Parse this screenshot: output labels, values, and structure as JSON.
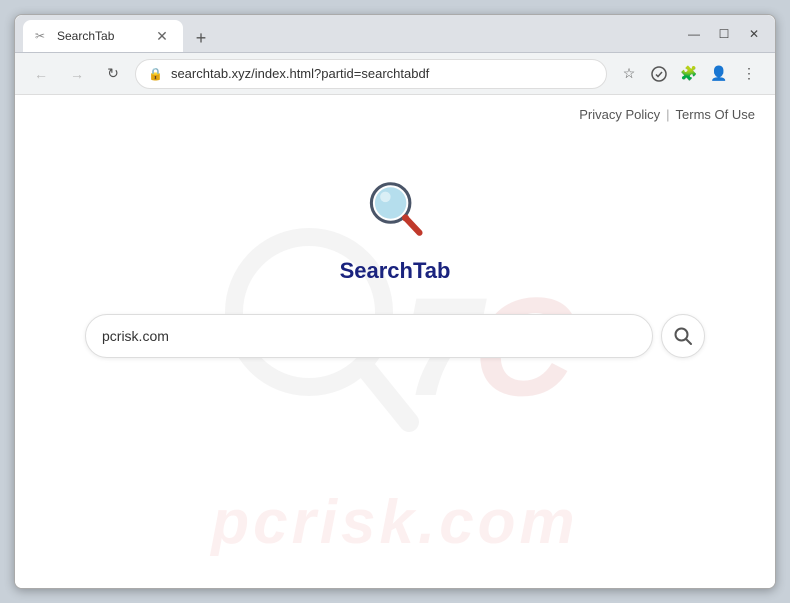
{
  "browser": {
    "tab": {
      "title": "SearchTab",
      "favicon": "🔍"
    },
    "new_tab_label": "+",
    "window_controls": {
      "minimize": "—",
      "maximize": "☐",
      "close": "✕"
    },
    "address_bar": {
      "url": "searchtab.xyz/index.html?partid=searchtabdf",
      "lock_icon": "🔒"
    },
    "nav": {
      "back": "←",
      "forward": "→",
      "refresh": "↻"
    },
    "toolbar": {
      "bookmark": "☆",
      "extensions": "🧩",
      "profile": "👤",
      "menu": "⋮",
      "shield": "🛡"
    }
  },
  "page": {
    "top_links": {
      "privacy_policy": "Privacy Policy",
      "divider": "|",
      "terms_of_use": "Terms Of Use"
    },
    "brand": {
      "name": "SearchTab",
      "name_prefix": "Search",
      "name_suffix": "Tab"
    },
    "search": {
      "placeholder": "pcrisk.com",
      "button_icon": "🔍"
    },
    "watermark": {
      "text": "7C"
    }
  }
}
